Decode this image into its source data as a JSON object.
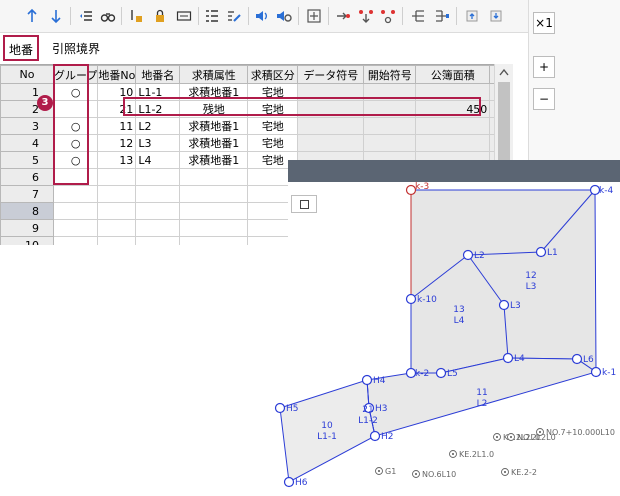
{
  "tabs": [
    "地番",
    "引照境界"
  ],
  "badge": "3",
  "columns": [
    "No",
    "グループ",
    "地番No",
    "地番名",
    "求積属性",
    "求積区分",
    "データ符号",
    "開始符号",
    "公簿面積"
  ],
  "rows": [
    {
      "no": "1",
      "group": "○",
      "chiban_no": "10",
      "name": "L1-1",
      "attr": "求積地番1",
      "kubun": "宅地",
      "data": "",
      "start": "",
      "area": ""
    },
    {
      "no": "2",
      "group": "",
      "chiban_no": "21",
      "name": "L1-2",
      "attr": "残地",
      "kubun": "宅地",
      "data": "",
      "start": "",
      "area": "450"
    },
    {
      "no": "3",
      "group": "○",
      "chiban_no": "11",
      "name": "L2",
      "attr": "求積地番1",
      "kubun": "宅地",
      "data": "",
      "start": "",
      "area": ""
    },
    {
      "no": "4",
      "group": "○",
      "chiban_no": "12",
      "name": "L3",
      "attr": "求積地番1",
      "kubun": "宅地",
      "data": "",
      "start": "",
      "area": ""
    },
    {
      "no": "5",
      "group": "○",
      "chiban_no": "13",
      "name": "L4",
      "attr": "求積地番1",
      "kubun": "宅地",
      "data": "",
      "start": "",
      "area": ""
    },
    {
      "no": "6",
      "group": "",
      "chiban_no": "",
      "name": "",
      "attr": "",
      "kubun": "",
      "data": "",
      "start": "",
      "area": ""
    },
    {
      "no": "7",
      "group": "",
      "chiban_no": "",
      "name": "",
      "attr": "",
      "kubun": "",
      "data": "",
      "start": "",
      "area": ""
    },
    {
      "no": "8",
      "group": "",
      "chiban_no": "",
      "name": "",
      "attr": "",
      "kubun": "",
      "data": "",
      "start": "",
      "area": ""
    },
    {
      "no": "9",
      "group": "",
      "chiban_no": "",
      "name": "",
      "attr": "",
      "kubun": "",
      "data": "",
      "start": "",
      "area": ""
    },
    {
      "no": "10",
      "group": "",
      "chiban_no": "",
      "name": "",
      "attr": "",
      "kubun": "",
      "data": "",
      "start": "",
      "area": ""
    }
  ],
  "right_panel": {
    "zoom": "×1",
    "plus": "+",
    "minus": "−"
  },
  "drawing": {
    "points": [
      {
        "label": "k-3",
        "name": "k3"
      },
      {
        "label": "k-4",
        "name": "k4"
      },
      {
        "label": "L1",
        "name": "L1"
      },
      {
        "label": "L2",
        "name": "L2"
      },
      {
        "label": "k-10",
        "name": "k10"
      },
      {
        "label": "L3",
        "name": "L3"
      },
      {
        "label": "L4",
        "name": "L4"
      },
      {
        "label": "L6",
        "name": "L6"
      },
      {
        "label": "k-1",
        "name": "k1"
      },
      {
        "label": "k-2",
        "name": "k2"
      },
      {
        "label": "L5",
        "name": "L5"
      },
      {
        "label": "H4",
        "name": "H4"
      },
      {
        "label": "H5",
        "name": "H5"
      },
      {
        "label": "H3",
        "name": "H3"
      },
      {
        "label": "H2",
        "name": "H2"
      },
      {
        "label": "H6",
        "name": "H6"
      }
    ],
    "parcel_labels": [
      {
        "a": "12",
        "b": "L3"
      },
      {
        "a": "13",
        "b": "L4"
      },
      {
        "a": "11",
        "b": "L2"
      },
      {
        "a": "10",
        "b": "L1-1"
      },
      {
        "a": "21",
        "b": "L1-2"
      }
    ],
    "markers": [
      "NO.7+10.000L10",
      "KE.2L2L0",
      "NO.2L2L0",
      "KE.2L1.0",
      "G1",
      "NO.6L10",
      "KE.2-2"
    ]
  }
}
